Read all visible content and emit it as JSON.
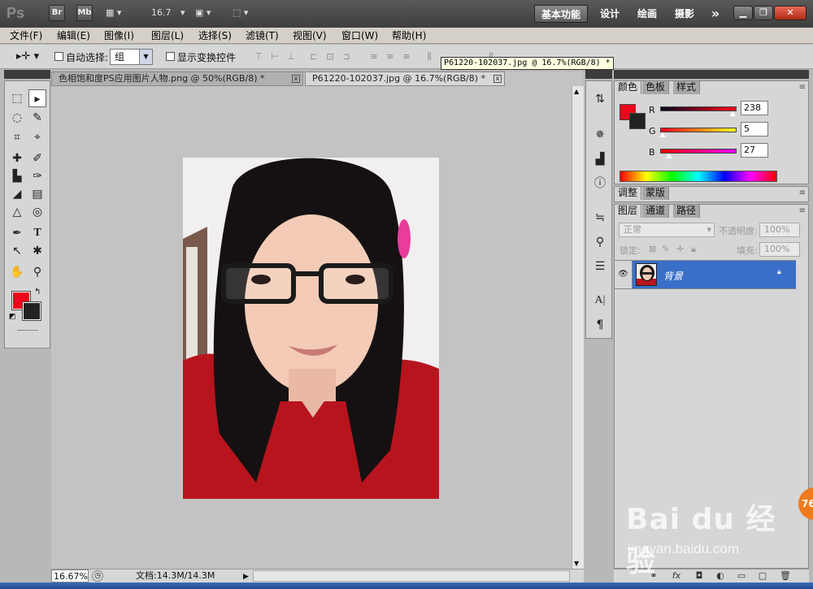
{
  "titlebar": {
    "logo": "Ps",
    "bridge": "Br",
    "minibridge": "Mb",
    "zoom_value": "16.7",
    "workspaces": [
      "基本功能",
      "设计",
      "绘画",
      "摄影"
    ],
    "more": "»"
  },
  "menubar": {
    "items": [
      "文件(F)",
      "编辑(E)",
      "图像(I)",
      "图层(L)",
      "选择(S)",
      "滤镜(T)",
      "视图(V)",
      "窗口(W)",
      "帮助(H)"
    ]
  },
  "options": {
    "auto_select_label": "自动选择:",
    "auto_select_value": "组",
    "show_transform_label": "显示变换控件",
    "tooltip": "P61220-102037.jpg @ 16.7%(RGB/8) *"
  },
  "tabs": [
    {
      "label": "色相饱和度PS应用图片人物.png @ 50%(RGB/8) *",
      "close": "x"
    },
    {
      "label": "P61220-102037.jpg @ 16.7%(RGB/8) *",
      "close": "x"
    }
  ],
  "status": {
    "zoom": "16.67%",
    "doc": "文档:14.3M/14.3M"
  },
  "color_panel": {
    "tabs": [
      "颜色",
      "色板",
      "样式"
    ],
    "r_label": "R",
    "g_label": "G",
    "b_label": "B",
    "r": "238",
    "g": "5",
    "b": "27",
    "r_fraction": 0.933,
    "g_fraction": 0.02,
    "b_fraction": 0.106,
    "foreground": "#ee051b",
    "background": "#222222"
  },
  "adjust_panel": {
    "tabs": [
      "调整",
      "蒙版"
    ]
  },
  "layers_panel": {
    "tabs": [
      "图层",
      "通道",
      "路径"
    ],
    "blend_mode": "正常",
    "opacity_label": "不透明度:",
    "opacity": "100%",
    "lock_label": "锁定:",
    "fill_label": "填充:",
    "fill": "100%",
    "layers": [
      {
        "name": "背景",
        "locked": true
      }
    ]
  },
  "watermark": {
    "brand": "Bai du 经验",
    "url": "jingyan.baidu.com"
  },
  "badge": "76",
  "icons": [
    "move-tool-icon",
    "marquee-icon",
    "lasso-icon",
    "quick-select-icon",
    "crop-icon",
    "eyedropper-icon",
    "healing-icon",
    "brush-icon",
    "stamp-icon",
    "history-brush-icon",
    "eraser-icon",
    "gradient-icon",
    "blur-icon",
    "dodge-icon",
    "pen-icon",
    "type-icon",
    "path-select-icon",
    "shape-icon",
    "hand-icon",
    "zoom-icon",
    "eye-icon",
    "lock-icon"
  ]
}
